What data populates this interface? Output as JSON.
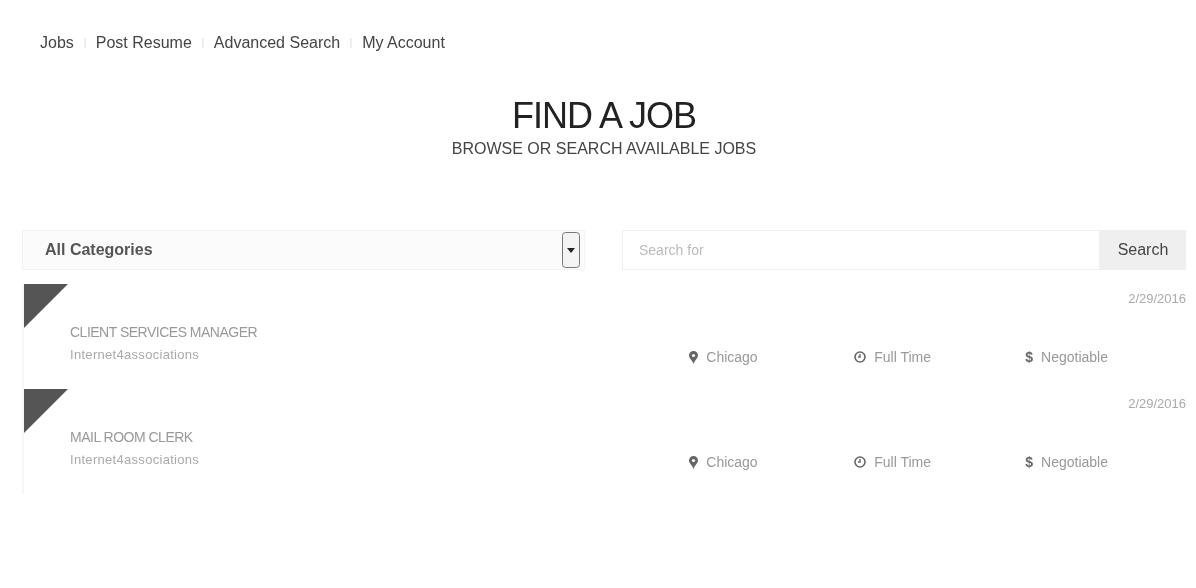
{
  "nav": [
    "Jobs",
    "Post Resume",
    "Advanced Search",
    "My Account"
  ],
  "header": {
    "title": "FIND A JOB",
    "subtitle": "BROWSE OR SEARCH AVAILABLE JOBS"
  },
  "filters": {
    "category": "All Categories",
    "search": {
      "placeholder": "Search for"
    },
    "button": "Search"
  },
  "jobs": [
    {
      "date": "2/29/2016",
      "title": "CLIENT SERVICES MANAGER",
      "company": "Internet4associations",
      "location": "Chicago",
      "type": "Full Time",
      "currency_symbol": "$",
      "salary": "Negotiable"
    },
    {
      "date": "2/29/2016",
      "title": "MAIL ROOM CLERK",
      "company": "Internet4associations",
      "location": "Chicago",
      "type": "Full Time",
      "currency_symbol": "$",
      "salary": "Negotiable"
    }
  ]
}
